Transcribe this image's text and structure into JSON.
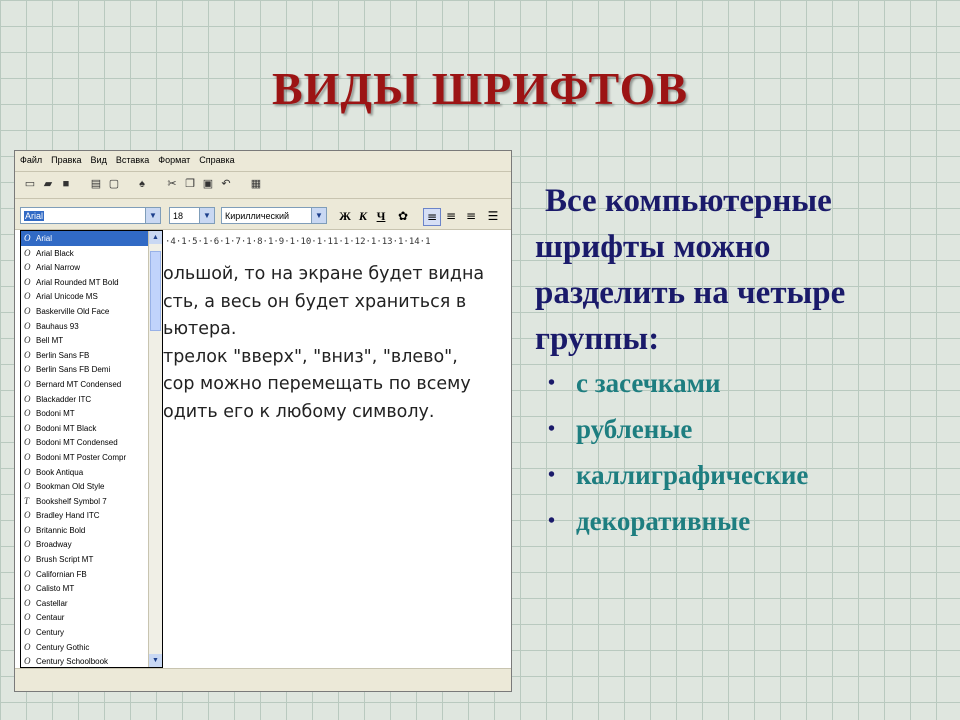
{
  "title": "ВИДЫ ШРИФТОВ",
  "intro": {
    "line1": "Все компьютерные",
    "line2": "шрифты можно",
    "line3": "разделить на четыре",
    "line4": "группы:"
  },
  "bullets": [
    "с засечками",
    "рубленые",
    "каллиграфические",
    "декоративные"
  ],
  "editor": {
    "menu": [
      "Файл",
      "Правка",
      "Вид",
      "Вставка",
      "Формат",
      "Справка"
    ],
    "font_value": "Arial",
    "size_value": "18",
    "script_value": "Кириллический",
    "bold_label": "Ж",
    "italic_label": "К",
    "underline_label": "Ч",
    "ruler": "·4·1·5·1·6·1·7·1·8·1·9·1·10·1·11·1·12·1·13·1·14·1",
    "doc_lines": [
      "ольшой, то на экране будет видна",
      "сть, а весь он будет храниться в",
      "ьютера.",
      "трелок \"вверх\", \"вниз\", \"влево\",",
      "сор можно перемещать по всему",
      "одить его к любому символу."
    ],
    "fonts": [
      "Arial",
      "Arial Black",
      "Arial Narrow",
      "Arial Rounded MT Bold",
      "Arial Unicode MS",
      "Baskerville Old Face",
      "Bauhaus 93",
      "Bell MT",
      "Berlin Sans FB",
      "Berlin Sans FB Demi",
      "Bernard MT Condensed",
      "Blackadder ITC",
      "Bodoni MT",
      "Bodoni MT Black",
      "Bodoni MT Condensed",
      "Bodoni MT Poster Compr",
      "Book Antiqua",
      "Bookman Old Style",
      "Bookshelf Symbol 7",
      "Bradley Hand ITC",
      "Britannic Bold",
      "Broadway",
      "Brush Script MT",
      "Californian FB",
      "Calisto MT",
      "Castellar",
      "Centaur",
      "Century",
      "Century Gothic",
      "Century Schoolbook"
    ],
    "font_icons": [
      "O",
      "O",
      "O",
      "O",
      "O",
      "O",
      "O",
      "O",
      "O",
      "O",
      "O",
      "O",
      "O",
      "O",
      "O",
      "O",
      "O",
      "O",
      "T",
      "O",
      "O",
      "O",
      "O",
      "O",
      "O",
      "O",
      "O",
      "O",
      "O",
      "O"
    ]
  },
  "colors": {
    "title": "#9c1414",
    "intro": "#1a1a6a",
    "bullets": "#1e7e80",
    "background": "#dfe6df"
  }
}
